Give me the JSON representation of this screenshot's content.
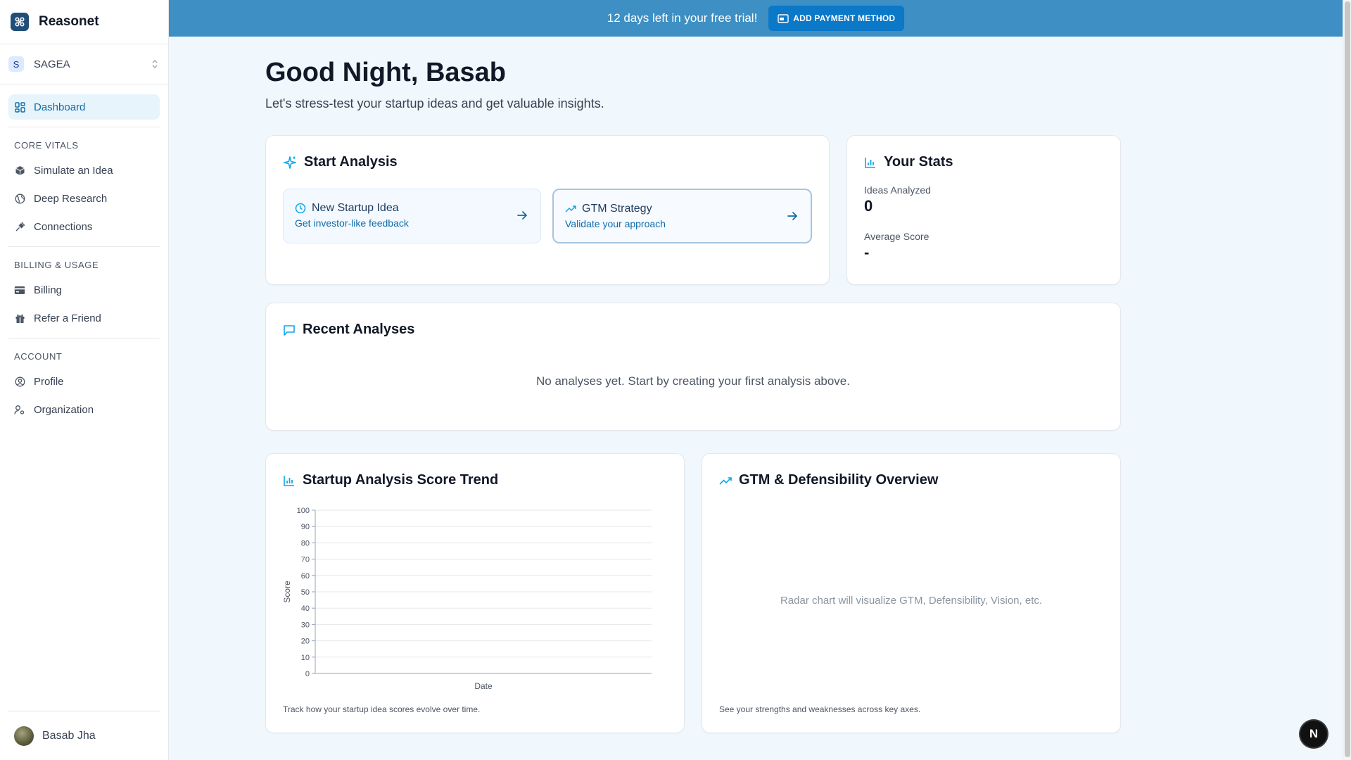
{
  "app": {
    "name": "Reasonet"
  },
  "org": {
    "initial": "S",
    "name": "SAGEA"
  },
  "nav": {
    "dashboard": "Dashboard",
    "sections": [
      {
        "label": "CORE VITALS",
        "items": [
          "Simulate an Idea",
          "Deep Research",
          "Connections"
        ]
      },
      {
        "label": "BILLING & USAGE",
        "items": [
          "Billing",
          "Refer a Friend"
        ]
      },
      {
        "label": "ACCOUNT",
        "items": [
          "Profile",
          "Organization"
        ]
      }
    ]
  },
  "user": {
    "name": "Basab Jha"
  },
  "banner": {
    "text": "12 days left in your free trial!",
    "button": "ADD PAYMENT METHOD"
  },
  "main": {
    "greeting": "Good Night, Basab",
    "subtitle": "Let's stress-test your startup ideas and get valuable insights."
  },
  "start_analysis": {
    "title": "Start Analysis",
    "actions": [
      {
        "title": "New Startup Idea",
        "subtitle": "Get investor-like feedback"
      },
      {
        "title": "GTM Strategy",
        "subtitle": "Validate your approach"
      }
    ]
  },
  "stats": {
    "title": "Your Stats",
    "ideas_label": "Ideas Analyzed",
    "ideas_value": "0",
    "score_label": "Average Score",
    "score_value": "-"
  },
  "recent": {
    "title": "Recent Analyses",
    "empty": "No analyses yet. Start by creating your first analysis above."
  },
  "trend": {
    "title": "Startup Analysis Score Trend",
    "footer": "Track how your startup idea scores evolve over time."
  },
  "radar": {
    "title": "GTM & Defensibility Overview",
    "placeholder": "Radar chart will visualize GTM, Defensibility, Vision, etc.",
    "footer": "See your strengths and weaknesses across key axes."
  },
  "fab": {
    "label": "N"
  },
  "colors": {
    "accent": "#0ea5e9",
    "banner": "#3d8fc4",
    "primary": "#0b78c8"
  },
  "chart_data": {
    "type": "line",
    "title": "Startup Analysis Score Trend",
    "xlabel": "Date",
    "ylabel": "Score",
    "x": [],
    "series": [],
    "ylim": [
      0,
      100
    ],
    "yticks": [
      "0",
      "10",
      "20",
      "30",
      "40",
      "50",
      "60",
      "70",
      "80",
      "90",
      "100"
    ],
    "grid": true
  }
}
